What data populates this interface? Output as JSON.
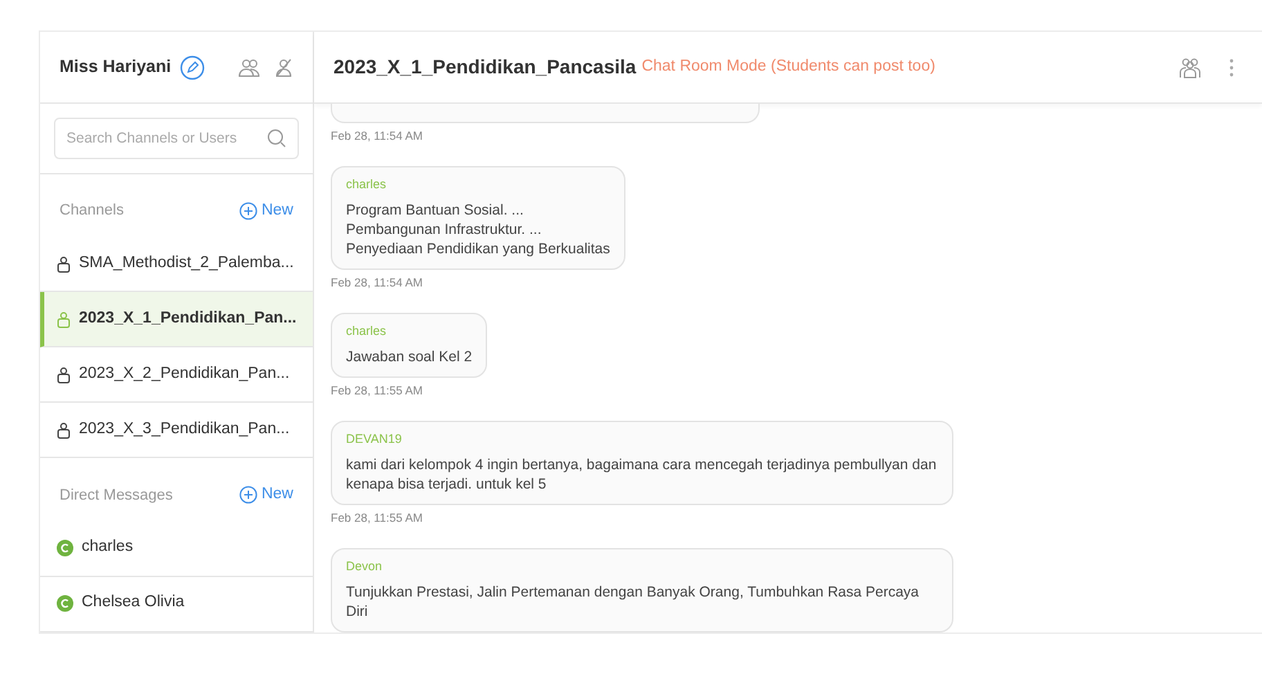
{
  "user": {
    "name": "Miss Hariyani"
  },
  "search": {
    "placeholder": "Search Channels or Users"
  },
  "channels": {
    "title": "Channels",
    "new_label": "New",
    "items": [
      {
        "name": "SMA_Methodist_2_Palemba...",
        "selected": false
      },
      {
        "name": "2023_X_1_Pendidikan_Pan...",
        "selected": true
      },
      {
        "name": "2023_X_2_Pendidikan_Pan...",
        "selected": false
      },
      {
        "name": "2023_X_3_Pendidikan_Pan...",
        "selected": false
      }
    ]
  },
  "direct_messages": {
    "title": "Direct Messages",
    "new_label": "New",
    "items": [
      {
        "name": "charles"
      },
      {
        "name": "Chelsea Olivia"
      }
    ]
  },
  "room": {
    "title": "2023_X_1_Pendidikan_Pancasila",
    "mode": "Chat Room Mode (Students can post too)"
  },
  "messages": [
    {
      "kind": "partial",
      "time": "Feb 28, 11:54 AM"
    },
    {
      "kind": "full",
      "author": "charles",
      "lines": [
        "Program Bantuan Sosial. ...",
        "Pembangunan Infrastruktur. ...",
        "Penyediaan Pendidikan yang Berkualitas"
      ],
      "time": "Feb 28, 11:54 AM"
    },
    {
      "kind": "full",
      "author": "charles",
      "lines": [
        "Jawaban soal Kel 2"
      ],
      "time": "Feb 28, 11:55 AM"
    },
    {
      "kind": "full",
      "author": "DEVAN19",
      "lines": [
        "kami dari kelompok 4 ingin bertanya, bagaimana cara mencegah terjadinya pembullyan dan kenapa bisa terjadi. untuk kel 5"
      ],
      "time": "Feb 28, 11:55 AM"
    },
    {
      "kind": "full",
      "author": "Devon",
      "lines": [
        "Tunjukkan Prestasi, Jalin Pertemanan dengan Banyak Orang, Tumbuhkan Rasa Percaya Diri"
      ]
    }
  ]
}
